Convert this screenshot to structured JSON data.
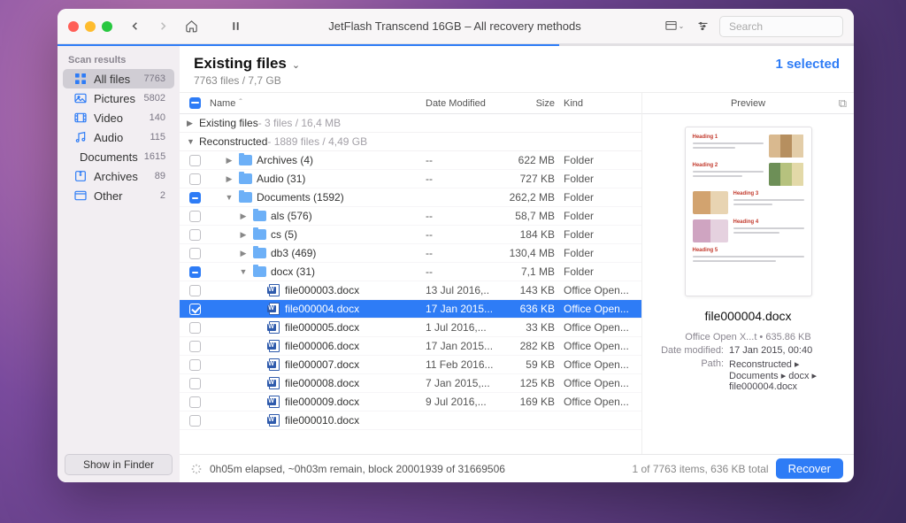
{
  "toolbar": {
    "title": "JetFlash Transcend 16GB – All recovery methods",
    "search_placeholder": "Search"
  },
  "sidebar": {
    "header": "Scan results",
    "items": [
      {
        "icon": "grid",
        "label": "All files",
        "count": "7763",
        "selected": true
      },
      {
        "icon": "pictures",
        "label": "Pictures",
        "count": "5802"
      },
      {
        "icon": "video",
        "label": "Video",
        "count": "140"
      },
      {
        "icon": "audio",
        "label": "Audio",
        "count": "115"
      },
      {
        "icon": "documents",
        "label": "Documents",
        "count": "1615"
      },
      {
        "icon": "archives",
        "label": "Archives",
        "count": "89"
      },
      {
        "icon": "other",
        "label": "Other",
        "count": "2"
      }
    ],
    "show_in_finder": "Show in Finder"
  },
  "header": {
    "title": "Existing files",
    "subtitle": "7763 files / 7,7 GB",
    "selected": "1 selected"
  },
  "columns": {
    "name": "Name",
    "date": "Date Modified",
    "size": "Size",
    "kind": "Kind"
  },
  "groups": [
    {
      "open": false,
      "name": "Existing files",
      "info": " - 3 files / 16,4 MB"
    },
    {
      "open": true,
      "name": "Reconstructed",
      "info": " - 1889 files / 4,49 GB"
    }
  ],
  "rows": [
    {
      "indent": 1,
      "chk": "empty",
      "disc": "▶",
      "type": "folder",
      "name": "Archives (4)",
      "date": "--",
      "size": "622 MB",
      "kind": "Folder"
    },
    {
      "indent": 1,
      "chk": "empty",
      "disc": "▶",
      "type": "folder",
      "name": "Audio (31)",
      "date": "--",
      "size": "727 KB",
      "kind": "Folder"
    },
    {
      "indent": 1,
      "chk": "minus",
      "disc": "▼",
      "type": "folder",
      "name": "Documents (1592)",
      "date": "",
      "size": "262,2 MB",
      "kind": "Folder"
    },
    {
      "indent": 2,
      "chk": "empty",
      "disc": "▶",
      "type": "folder",
      "name": "als (576)",
      "date": "--",
      "size": "58,7 MB",
      "kind": "Folder"
    },
    {
      "indent": 2,
      "chk": "empty",
      "disc": "▶",
      "type": "folder",
      "name": "cs (5)",
      "date": "--",
      "size": "184 KB",
      "kind": "Folder"
    },
    {
      "indent": 2,
      "chk": "empty",
      "disc": "▶",
      "type": "folder",
      "name": "db3 (469)",
      "date": "--",
      "size": "130,4 MB",
      "kind": "Folder"
    },
    {
      "indent": 2,
      "chk": "minus",
      "disc": "▼",
      "type": "folder",
      "name": "docx (31)",
      "date": "--",
      "size": "7,1 MB",
      "kind": "Folder"
    },
    {
      "indent": 3,
      "chk": "empty",
      "disc": "",
      "type": "doc",
      "name": "file000003.docx",
      "date": "13 Jul 2016,..",
      "size": "143 KB",
      "kind": "Office Open..."
    },
    {
      "indent": 3,
      "chk": "check",
      "disc": "",
      "type": "doc",
      "name": "file000004.docx",
      "date": "17 Jan 2015...",
      "size": "636 KB",
      "kind": "Office Open...",
      "selected": true
    },
    {
      "indent": 3,
      "chk": "empty",
      "disc": "",
      "type": "doc",
      "name": "file000005.docx",
      "date": "1 Jul 2016,...",
      "size": "33 KB",
      "kind": "Office Open..."
    },
    {
      "indent": 3,
      "chk": "empty",
      "disc": "",
      "type": "doc",
      "name": "file000006.docx",
      "date": "17 Jan 2015...",
      "size": "282 KB",
      "kind": "Office Open..."
    },
    {
      "indent": 3,
      "chk": "empty",
      "disc": "",
      "type": "doc",
      "name": "file000007.docx",
      "date": "11 Feb 2016...",
      "size": "59 KB",
      "kind": "Office Open..."
    },
    {
      "indent": 3,
      "chk": "empty",
      "disc": "",
      "type": "doc",
      "name": "file000008.docx",
      "date": "7 Jan 2015,...",
      "size": "125 KB",
      "kind": "Office Open..."
    },
    {
      "indent": 3,
      "chk": "empty",
      "disc": "",
      "type": "doc",
      "name": "file000009.docx",
      "date": "9 Jul 2016,...",
      "size": "169 KB",
      "kind": "Office Open..."
    },
    {
      "indent": 3,
      "chk": "empty",
      "disc": "",
      "type": "doc",
      "name": "file000010.docx",
      "date": "",
      "size": "",
      "kind": ""
    }
  ],
  "preview": {
    "header": "Preview",
    "name": "file000004.docx",
    "type_size": "Office Open X...t • 635.86 KB",
    "date_label": "Date modified:",
    "date": "17 Jan 2015, 00:40",
    "path_label": "Path:",
    "path": "Reconstructed ▸ Documents ▸ docx ▸ file000004.docx",
    "thumb_headings": [
      "Heading 1",
      "Heading 2",
      "Heading 3",
      "Heading 4",
      "Heading 5"
    ]
  },
  "footer": {
    "status": "0h05m elapsed, ~0h03m remain, block 20001939 of 31669506",
    "summary": "1 of 7763 items, 636 KB total",
    "recover": "Recover"
  }
}
